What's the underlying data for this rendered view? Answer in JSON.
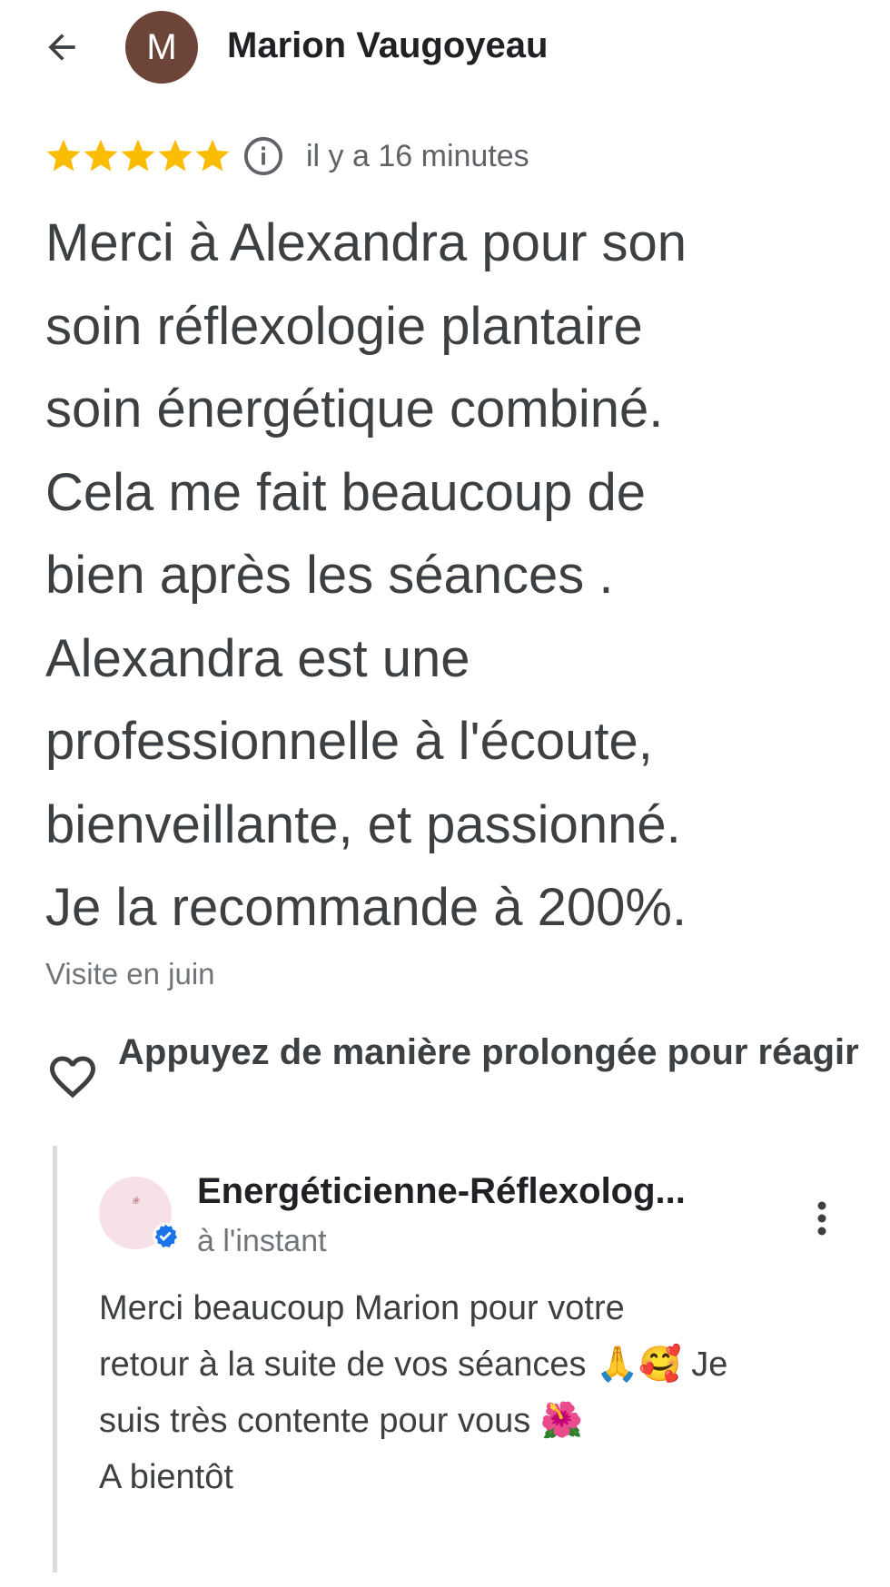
{
  "header": {
    "back_icon": "arrow-left-icon",
    "avatar_initial": "M",
    "avatar_color": "#6d4538",
    "reviewer_name": "Marion Vaugoyeau"
  },
  "review": {
    "rating": 5,
    "rating_max": 5,
    "star_color": "#fbbc04",
    "time": "il y a 16 minutes",
    "text_lines": [
      "Merci à Alexandra pour son",
      "soin réflexologie plantaire",
      "soin énergétique combiné.",
      "Cela me fait beaucoup de",
      "bien après les séances .",
      "Alexandra est une",
      "professionnelle à l'écoute,",
      "bienveillante, et passionné.",
      "Je la recommande à 200%."
    ],
    "visit": "Visite en juin"
  },
  "reaction": {
    "icon": "heart-outline-icon",
    "hint": "Appuyez de manière prolongée pour réagir"
  },
  "owner_reply": {
    "name": "Energéticienne-Réflexolog...",
    "time": "à l'instant",
    "verified_color": "#1a73e8",
    "reply_lines": [
      "Merci beaucoup Marion pour votre",
      "retour à la suite de vos séances 🙏🥰 Je",
      "suis très contente pour vous 🌺",
      "A bientôt"
    ]
  }
}
